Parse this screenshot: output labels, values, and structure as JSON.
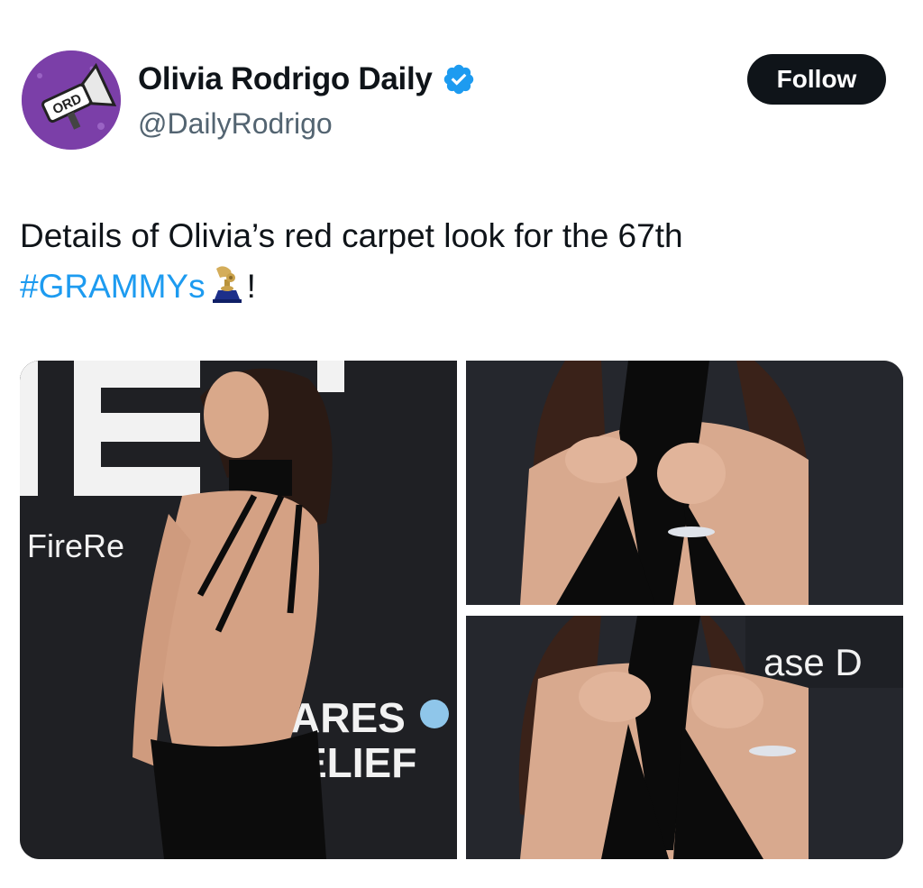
{
  "author": {
    "display_name": "Olivia Rodrigo Daily",
    "handle": "@DailyRodrigo",
    "verified_icon": "verified-badge-icon",
    "avatar_text": "ORD"
  },
  "follow_label": "Follow",
  "tweet": {
    "text_before": "Details of Olivia’s red carpet look for the 67th",
    "hashtag": "#GRAMMYs",
    "emoji_icon": "grammy-trophy-icon",
    "text_after": "!"
  },
  "media": {
    "photo1_backdrop_text_1": "FireRe",
    "photo1_backdrop_text_2": "ARES",
    "photo1_backdrop_text_3": "ELIEF",
    "photo3_backdrop_text": "ase D"
  },
  "colors": {
    "accent": "#1d9bf0",
    "text": "#0f1419",
    "secondary": "#536471",
    "avatar": "#7b3fa8"
  }
}
